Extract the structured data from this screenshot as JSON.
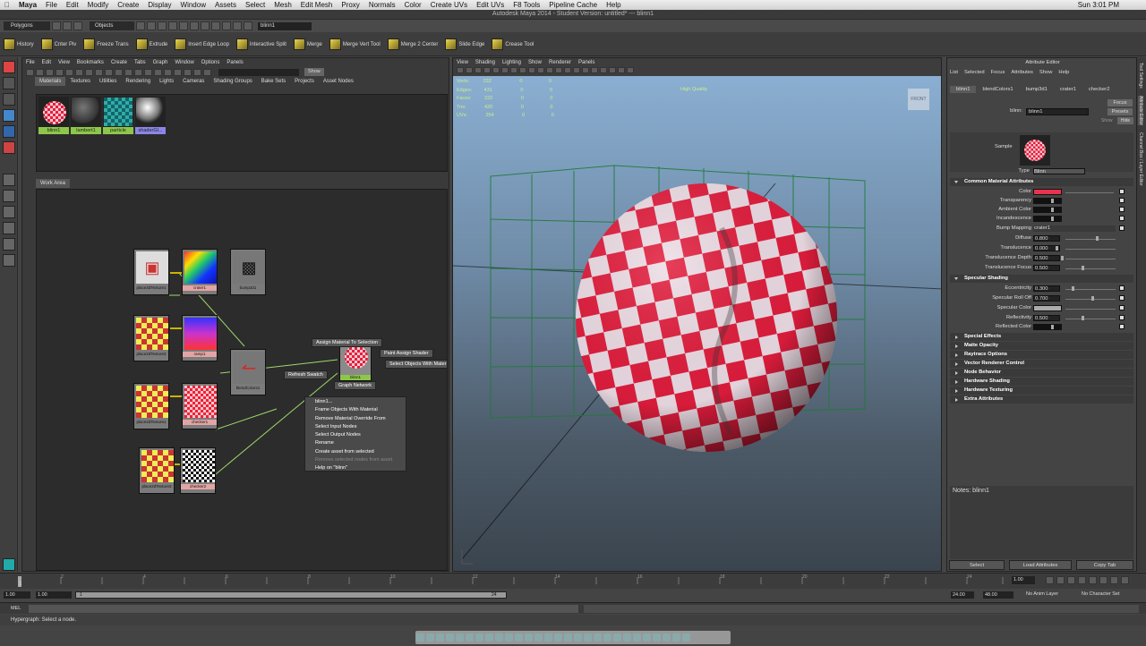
{
  "mac_menu": {
    "apple": "",
    "app": "Maya",
    "items": [
      "File",
      "Edit",
      "Modify",
      "Create",
      "Display",
      "Window",
      "Assets",
      "Select",
      "Mesh",
      "Edit Mesh",
      "Proxy",
      "Normals",
      "Color",
      "Create UVs",
      "Edit UVs",
      "F8 Tools",
      "Pipeline Cache",
      "Help"
    ],
    "clock": "Sun 3:01 PM"
  },
  "window_title": "Autodesk Maya 2014 - Student Version: untitled*   ---   blinn1",
  "status_line": {
    "menuset": "Polygons",
    "objects": "Objects",
    "sel_field": "blinn1"
  },
  "shelf": [
    "History",
    "Cnter Piv",
    "Freeze Trans",
    "Extrude",
    "Insert Edge Loop",
    "Interactive Split",
    "Merge",
    "Merge Vert Tool",
    "Merge 2 Center",
    "Slide Edge",
    "Crease Tool"
  ],
  "hypershade": {
    "menu": [
      "File",
      "Edit",
      "View",
      "Bookmarks",
      "Create",
      "Tabs",
      "Graph",
      "Window",
      "Options",
      "Panels"
    ],
    "show_button": "Show",
    "tabs": [
      "Materials",
      "Textures",
      "Utilities",
      "Rendering",
      "Lights",
      "Cameras",
      "Shading Groups",
      "Bake Sets",
      "Projects",
      "Asset Nodes"
    ],
    "materials": [
      "blinn1",
      "lambert1",
      "particle",
      "shaderGl..."
    ],
    "work_area_tab": "Work Area",
    "nodes": [
      "place3dTexture1",
      "crater1",
      "bump3d1",
      "place2dTexture2",
      "ramp1",
      "blendColors1",
      "place2dTexture1",
      "checker1",
      "place2dTexture3",
      "checker2",
      "blinn1"
    ],
    "popups": {
      "assign": "Assign Material To Selection",
      "paint": "Paint Assign Shader",
      "select_objs": "Select Objects With Material",
      "refresh": "Refresh Swatch",
      "graph": "Graph Network"
    },
    "context_menu": [
      "blinn1...",
      "Frame Objects With Material",
      "Remove Material Override From",
      "Select Input Nodes",
      "Select Output Nodes",
      "Rename",
      "Create asset from selected",
      "Remove selected nodes from asset",
      "Help on \"blinn\""
    ]
  },
  "viewport": {
    "menu": [
      "View",
      "Shading",
      "Lighting",
      "Show",
      "Renderer",
      "Panels"
    ],
    "hud": [
      [
        "Verts:",
        "232",
        "0",
        "0"
      ],
      [
        "Edges:",
        "431",
        "0",
        "0"
      ],
      [
        "Faces:",
        "222",
        "0",
        "0"
      ],
      [
        "Tris:",
        "420",
        "0",
        "0"
      ],
      [
        "UVs:",
        "254",
        "0",
        "0"
      ]
    ],
    "quality": "High Quality",
    "viewcube": "FRONT"
  },
  "attr_editor": {
    "title": "Attribute Editor",
    "menu": [
      "List",
      "Selected",
      "Focus",
      "Attributes",
      "Show",
      "Help"
    ],
    "tabs": [
      "blinn1",
      "blendColors1",
      "bump3d1",
      "crater1",
      "checker2"
    ],
    "name_label": "blinn:",
    "name_value": "blinn1",
    "focus": "Focus",
    "presets": "Presets",
    "show": "Show",
    "hide": "Hide",
    "sample": "Sample",
    "type_label": "Type",
    "type_value": "Blinn",
    "common": "Common Material Attributes",
    "attrs": [
      {
        "label": "Color",
        "value": ""
      },
      {
        "label": "Transparency",
        "value": ""
      },
      {
        "label": "Ambient Color",
        "value": ""
      },
      {
        "label": "Incandescence",
        "value": ""
      },
      {
        "label": "Bump Mapping",
        "value": "crater1"
      },
      {
        "label": "Diffuse",
        "value": "0.800"
      },
      {
        "label": "Translucence",
        "value": "0.000"
      },
      {
        "label": "Translucence Depth",
        "value": "0.500"
      },
      {
        "label": "Translucence Focus",
        "value": "0.500"
      }
    ],
    "specular": "Specular Shading",
    "spec_attrs": [
      {
        "label": "Eccentricity",
        "value": "0.300"
      },
      {
        "label": "Specular Roll Off",
        "value": "0.700"
      },
      {
        "label": "Specular Color",
        "value": ""
      },
      {
        "label": "Reflectivity",
        "value": "0.500"
      },
      {
        "label": "Reflected Color",
        "value": ""
      }
    ],
    "sections": [
      "Special Effects",
      "Matte Opacity",
      "Raytrace Options",
      "Vector Renderer Control",
      "Node Behavior",
      "Hardware Shading",
      "Hardware Texturing",
      "Extra Attributes"
    ],
    "notes": "Notes:  blinn1",
    "buttons": [
      "Select",
      "Load Attributes",
      "Copy Tab"
    ],
    "side_tabs": [
      "Tool Settings",
      "Attribute Editor",
      "Channel Box / Layer Editor"
    ]
  },
  "timeline": {
    "ticks": [
      "1",
      "2",
      "4",
      "6",
      "8",
      "10",
      "12",
      "14",
      "16",
      "18",
      "20",
      "22",
      "24"
    ],
    "current": "1.00"
  },
  "range": {
    "start": "1.00",
    "start2": "1.00",
    "slider_start": "1",
    "slider_end": "24",
    "end": "24.00",
    "end2": "48.00",
    "anim_layer": "No Anim Layer",
    "char_set": "No Character Set"
  },
  "cmd_label": "MEL",
  "help_line": "Hypergraph: Select a node."
}
